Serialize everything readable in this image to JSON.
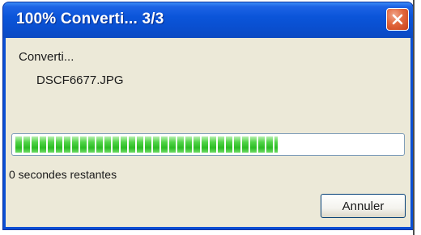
{
  "window": {
    "title": "100% Converti...  3/3",
    "close_icon": "close-icon"
  },
  "status": {
    "action": "Converti...",
    "filename": "DSCF6677.JPG",
    "time_remaining": "0 secondes restantes"
  },
  "progress": {
    "fraction": 0.68,
    "color": "#2cbc24"
  },
  "buttons": {
    "cancel_label": "Annuler"
  }
}
